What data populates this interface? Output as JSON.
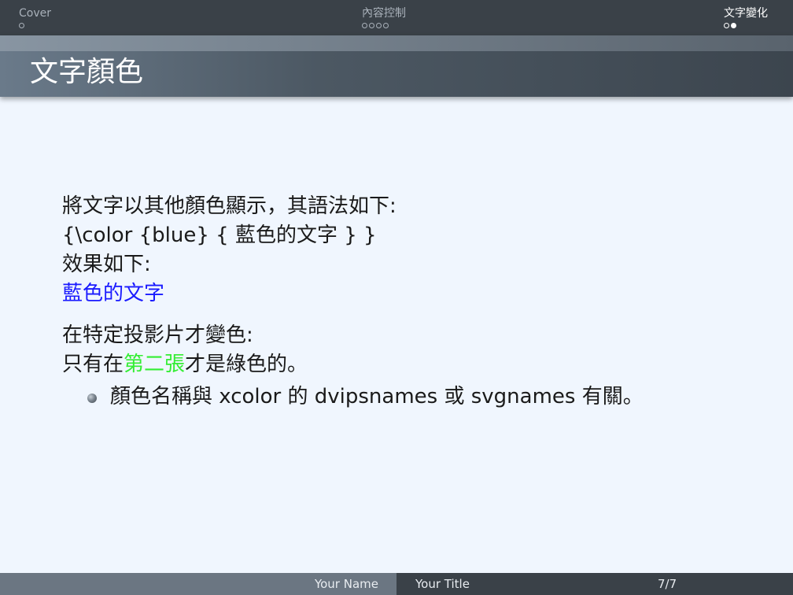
{
  "navbar": {
    "sections": [
      {
        "title": "Cover",
        "dots": 1,
        "current_dot": -1
      },
      {
        "title": "內容控制",
        "dots": 4,
        "current_dot": -1
      },
      {
        "title": "文字變化",
        "dots": 2,
        "current_dot": 1
      }
    ]
  },
  "frame": {
    "title": "文字顏色"
  },
  "content": {
    "intro": "將文字以其他顏色顯示，其語法如下:",
    "syntax": "{\\color {blue} { 藍色的文字 } }",
    "effect_label": "效果如下:",
    "blue_example": "藍色的文字",
    "overlay_label": "在特定投影片才變色:",
    "overlay_prefix": "只有在",
    "overlay_green": "第二張",
    "overlay_suffix": "才是綠色的。",
    "bullets": [
      "顏色名稱與 xcolor 的 dvipsnames 或 svgnames 有關。"
    ]
  },
  "footer": {
    "author": "Your Name",
    "title": "Your Title",
    "page": "7/7"
  },
  "colors": {
    "blue_text": "#1a1aff",
    "green_text": "#33ee33",
    "background": "#f0f6fe",
    "bar": "#3a4148"
  }
}
